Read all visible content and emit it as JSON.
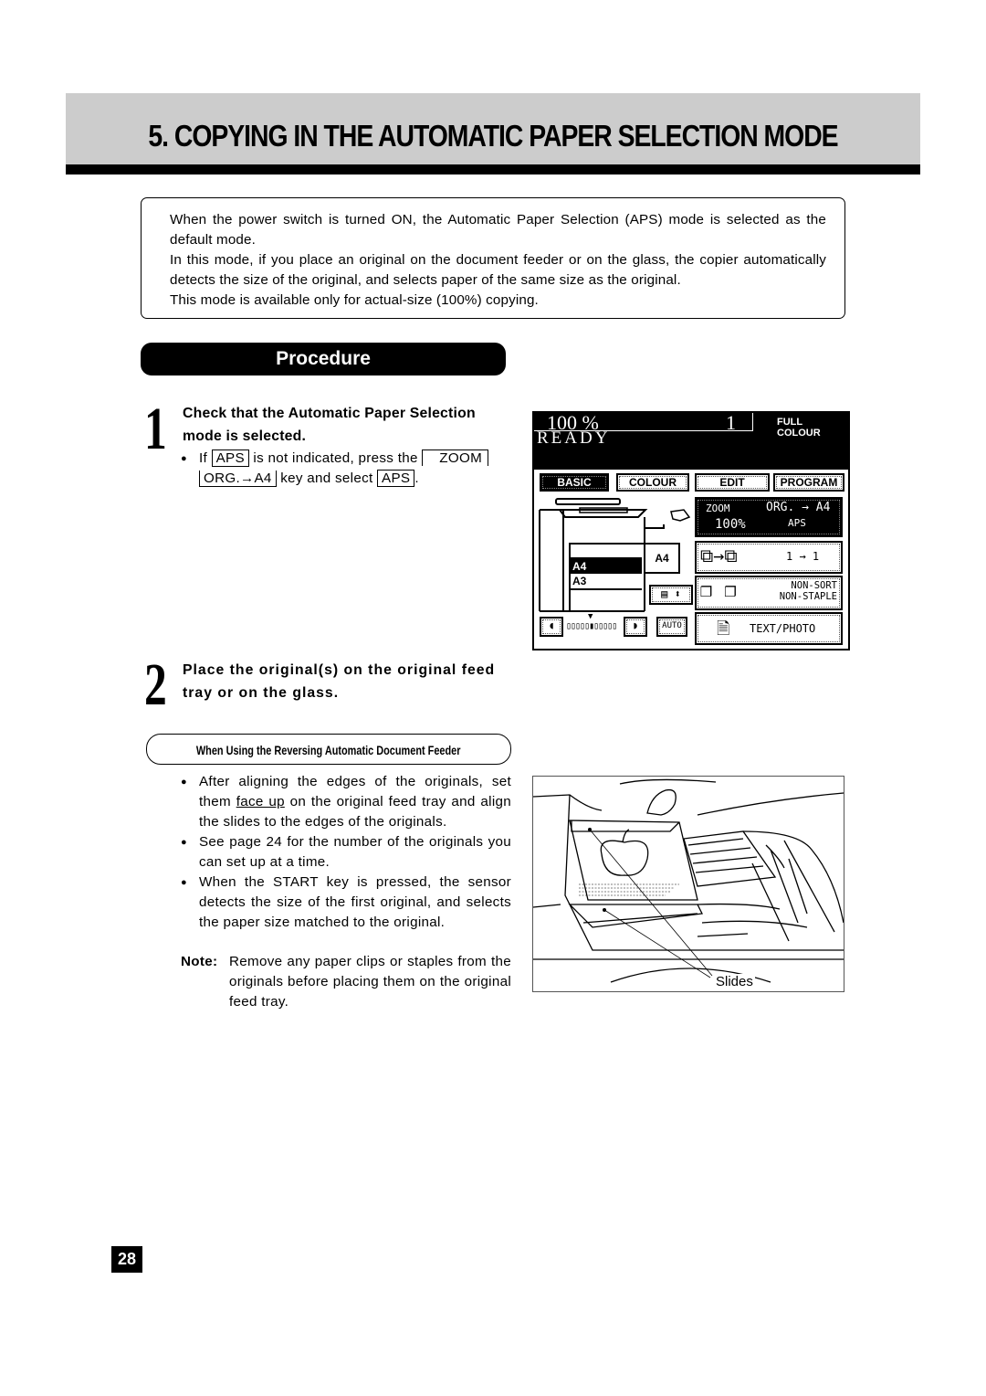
{
  "header": {
    "title": "5. COPYING IN THE AUTOMATIC PAPER SELECTION MODE"
  },
  "intro": {
    "paragraphs": [
      "When the power switch is turned ON, the Automatic Paper Selection (APS) mode is selected as the default mode.",
      "In this mode, if you place an original on the document feeder or on the glass, the copier automatically detects the size of the original, and selects paper of the same size as the original.",
      "This mode is available only for actual-size (100%) copying."
    ]
  },
  "procedure": {
    "label": "Procedure",
    "steps": [
      {
        "number": "1",
        "title_line1": "Check that the Automatic Paper Selection",
        "title_line2": "mode is selected.",
        "bullet": {
          "part1": "If",
          "key1": "APS",
          "part2": "is not indicated, press the",
          "key2_line1": "ZOOM",
          "key2_line2": "ORG.→A4",
          "part3": "key and select",
          "key3": "APS",
          "part4": "."
        }
      },
      {
        "number": "2",
        "title_line1": "Place the original(s) on the original feed",
        "title_line2": "tray or on the glass.",
        "subsection": "When Using the Reversing Automatic Document Feeder",
        "bullets": [
          {
            "before": "After aligning the edges of the originals, set them ",
            "underlined": "face up",
            "after": " on the original feed tray and align the slides to the edges of the originals."
          },
          {
            "text": "See page 24 for the number of the originals you can set up at a time."
          },
          {
            "text": "When the START key is pressed, the sensor detects the size of the first original, and selects the paper size matched to the original."
          }
        ],
        "note_label": "Note:",
        "note_text": "Remove any paper clips or staples from the originals before placing them on the original feed tray."
      }
    ]
  },
  "copier_screen": {
    "zoom_percent": "100  %",
    "copy_count": "1",
    "color_mode": "FULL COLOUR",
    "status": "READY",
    "tabs": [
      "BASIC",
      "COLOUR",
      "EDIT",
      "PROGRAM"
    ],
    "active_tab": "BASIC",
    "zoom_button": {
      "label": "ZOOM",
      "value": "100%",
      "org": "ORG. → A4",
      "aps": "APS"
    },
    "trays": [
      "",
      "A4",
      "A3",
      ""
    ],
    "selected_tray": "A4",
    "bypass_size": "A4",
    "duplex_label": "1 → 1",
    "sort_label_1": "NON-SORT",
    "sort_label_2": "NON-STAPLE",
    "original_mode": "TEXT/PHOTO",
    "density_auto": "AUTO"
  },
  "illustration": {
    "callout": "Slides"
  },
  "page_number": "28"
}
